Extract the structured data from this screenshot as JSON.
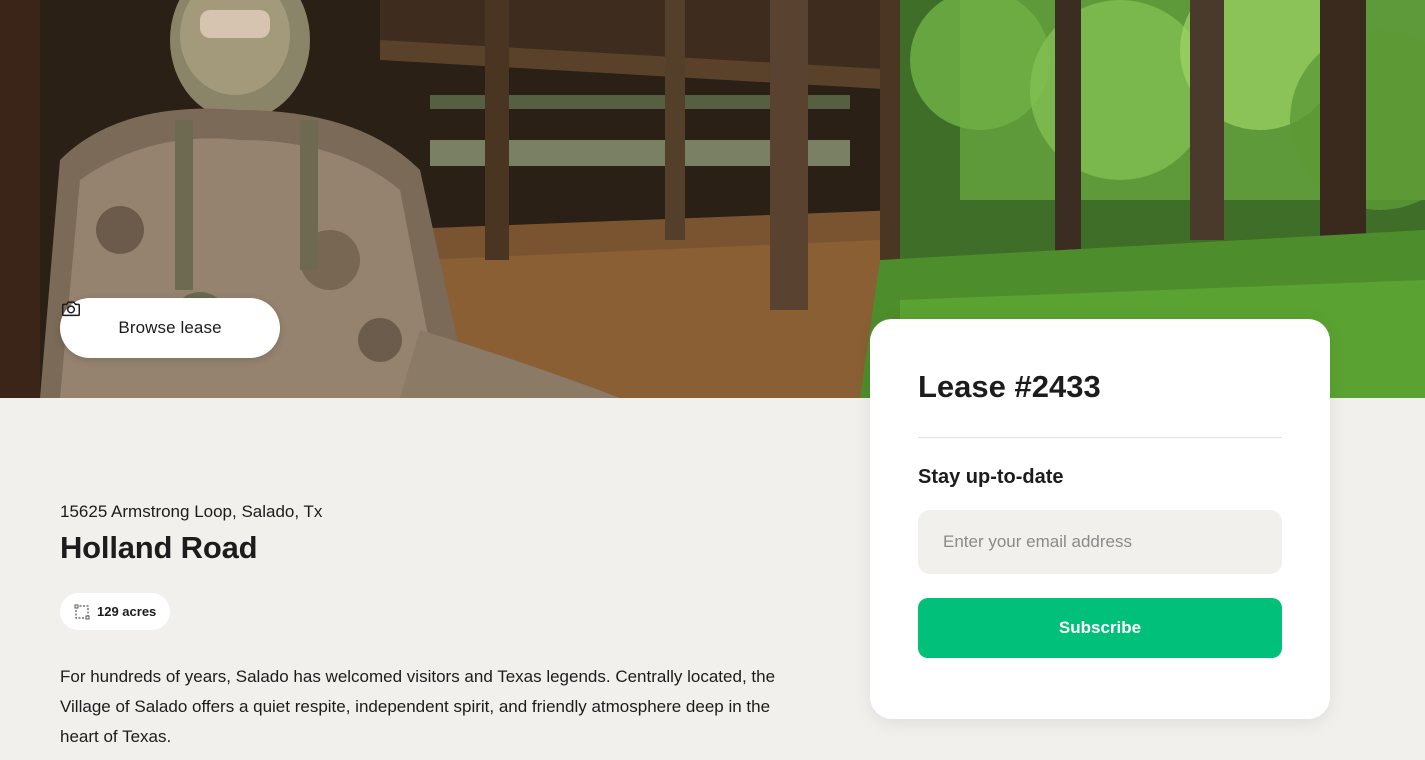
{
  "hero": {
    "image_alt": "Hunter in camouflage sitting under a wooden shelter next to green forest",
    "browse_button_label": "Browse lease",
    "browse_button_icon": "camera-icon"
  },
  "listing": {
    "address": "15625 Armstrong Loop, Salado, Tx",
    "title": "Holland Road",
    "acres_label": "129 acres",
    "acres_icon": "area-icon",
    "description": "For hundreds of years, Salado has welcomed visitors and Texas legends. Centrally located, the Village of Salado offers a quiet respite, independent spirit, and friendly atmosphere deep in the heart of Texas."
  },
  "card": {
    "lease_title": "Lease #2433",
    "stay_label": "Stay up-to-date",
    "email_placeholder": "Enter your email address",
    "email_value": "",
    "subscribe_label": "Subscribe"
  },
  "colors": {
    "page_background": "#f1f0ed",
    "accent_green": "#00c07a",
    "text": "#1c1c1c",
    "card_background": "#ffffff"
  }
}
